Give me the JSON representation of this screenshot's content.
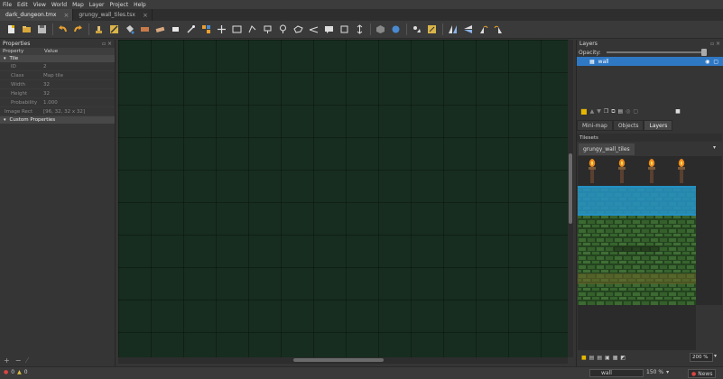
{
  "menu": [
    "File",
    "Edit",
    "View",
    "World",
    "Map",
    "Layer",
    "Project",
    "Help"
  ],
  "tabs": [
    {
      "label": "dark_dungeon.tmx",
      "active": true
    },
    {
      "label": "grungy_wall_tiles.tsx",
      "active": false
    }
  ],
  "toolbar_icons": [
    "new-icon",
    "open-icon",
    "save-icon",
    "undo-icon",
    "redo-icon",
    "stamp-brush-icon",
    "terrain-brush-icon",
    "bucket-fill-icon",
    "shape-fill-icon",
    "eraser-icon",
    "rect-select-icon",
    "magic-wand-icon",
    "select-same-icon",
    "move-icon",
    "rect-object-icon",
    "point-object-icon",
    "ellipse-object-icon",
    "polygon-object-icon",
    "tile-object-icon",
    "template-icon",
    "text-object-icon",
    "insert-object-icon",
    "world-tool-icon",
    "random-mode-icon",
    "wang-fill-icon",
    "flip-h-icon",
    "flip-v-icon",
    "rotate-left-icon",
    "rotate-right-icon"
  ],
  "properties": {
    "title": "Properties",
    "col_property": "Property",
    "col_value": "Value",
    "group": "Tile",
    "rows": [
      {
        "key": "ID",
        "value": "2"
      },
      {
        "key": "Class",
        "value": "Map tile"
      },
      {
        "key": "Width",
        "value": "32"
      },
      {
        "key": "Height",
        "value": "32"
      },
      {
        "key": "Probability",
        "value": "1.000"
      },
      {
        "key": "Image Rect",
        "value": "[96, 32, 32 x 32]"
      }
    ],
    "custom_group": "Custom Properties"
  },
  "layers": {
    "title": "Layers",
    "opacity_label": "Opacity:",
    "items": [
      {
        "name": "wall",
        "selected": true
      }
    ]
  },
  "dock_tabs": [
    "Mini-map",
    "Objects",
    "Layers"
  ],
  "tilesets": {
    "title": "Tilesets",
    "tab": "grungy_wall_tiles",
    "zoom": "200 %"
  },
  "status": {
    "warnings": "0",
    "errors": "0",
    "layer": "wall",
    "zoom": "150 %",
    "news": "News"
  },
  "colors": {
    "canvas_bg": "#172d1f",
    "selection": "#2f78c4"
  }
}
